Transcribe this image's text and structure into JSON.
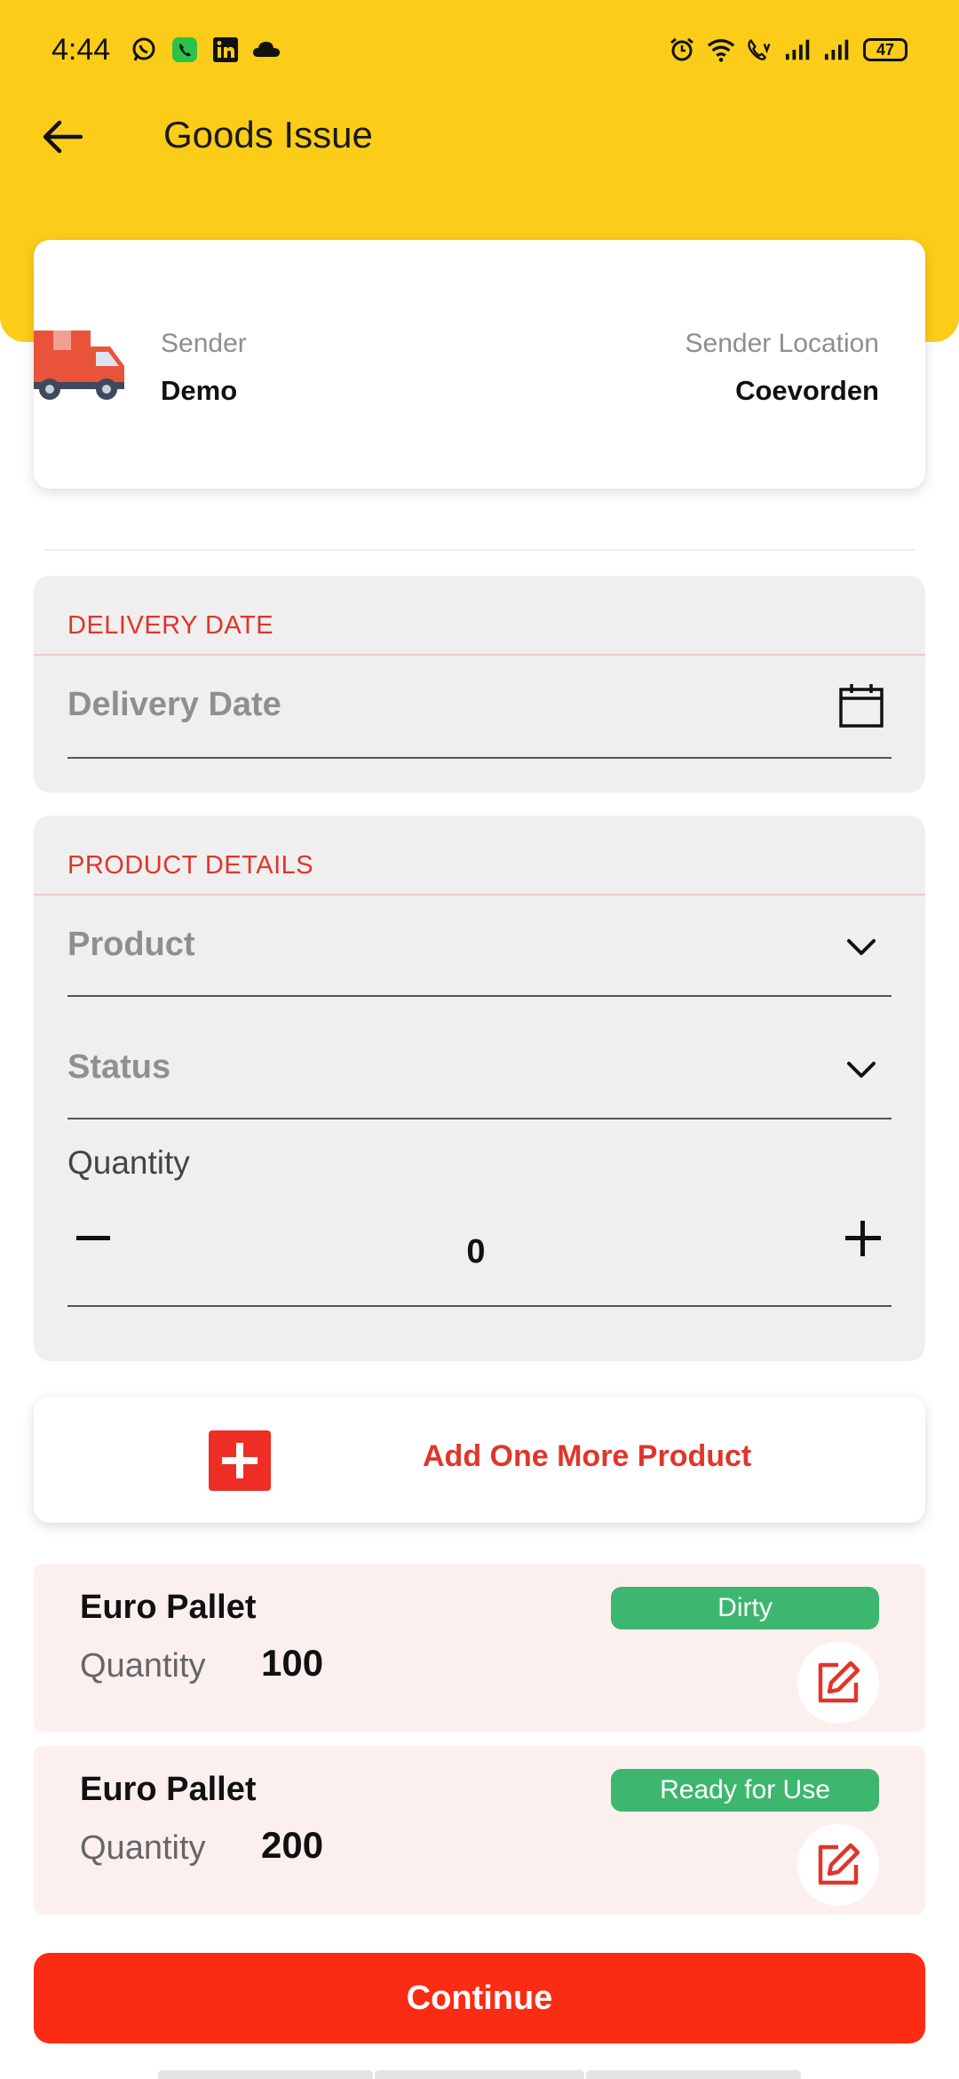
{
  "status_bar": {
    "time": "4:44",
    "left_icons": [
      "whatsapp-icon",
      "phone-app-icon",
      "linkedin-icon",
      "cloud-icon"
    ],
    "right_icons": [
      "alarm-icon",
      "wifi-icon",
      "volte-call-icon",
      "signal-icon",
      "signal-icon"
    ],
    "battery": "47"
  },
  "app_bar": {
    "title": "Goods Issue",
    "back_icon": "arrow-left-icon"
  },
  "sender_card": {
    "sender_label": "Sender",
    "sender_value": "Demo",
    "location_label": "Sender Location",
    "location_value": "Coevorden"
  },
  "delivery_section": {
    "title": "DELIVERY DATE",
    "field_placeholder": "Delivery Date",
    "field_icon": "calendar-icon"
  },
  "product_section": {
    "title": "PRODUCT DETAILS",
    "product_placeholder": "Product",
    "status_placeholder": "Status",
    "quantity_label": "Quantity",
    "quantity_value": "0"
  },
  "add_product": {
    "label": "Add One More Product"
  },
  "products": [
    {
      "name": "Euro Pallet",
      "quantity_label": "Quantity",
      "quantity": "100",
      "status": "Dirty"
    },
    {
      "name": "Euro Pallet",
      "quantity_label": "Quantity",
      "quantity": "200",
      "status": "Ready for Use"
    }
  ],
  "continue_label": "Continue",
  "colors": {
    "header_yellow": "#FCCD18",
    "accent_red": "#E0352B",
    "continue_red": "#FC2B14",
    "badge_green": "#3DB66F"
  }
}
